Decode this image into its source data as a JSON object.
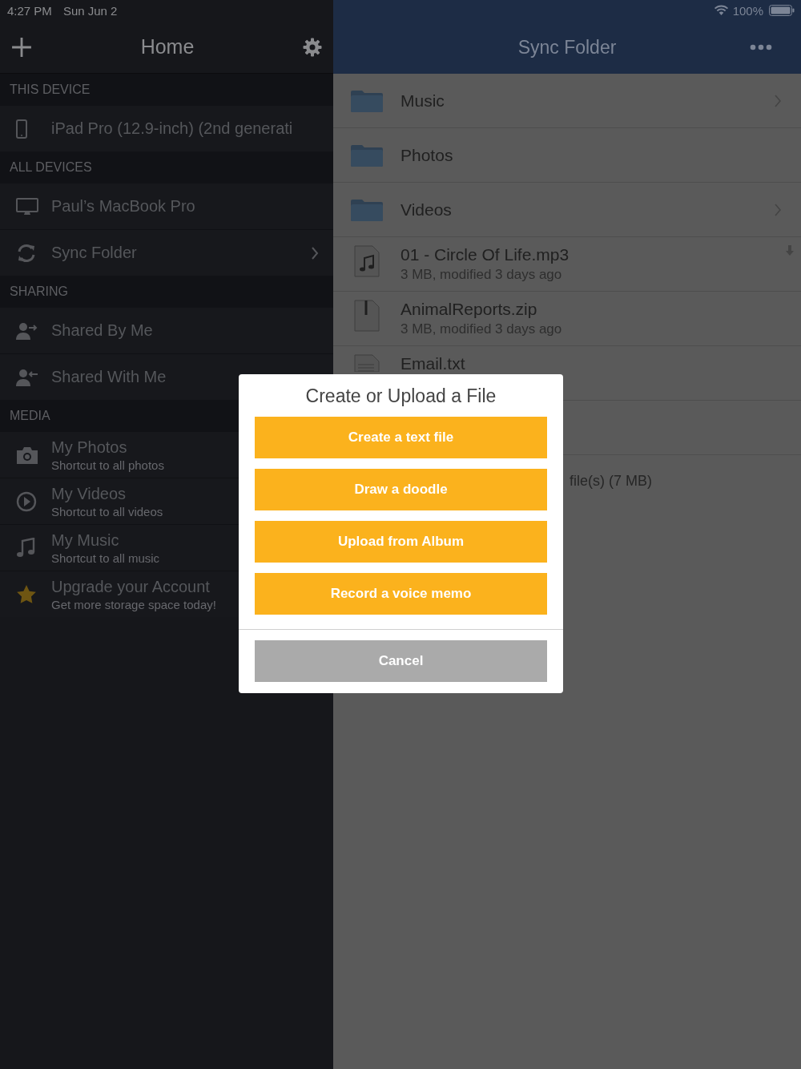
{
  "status_bar": {
    "time": "4:27 PM",
    "date": "Sun Jun 2",
    "battery": "100%"
  },
  "sidebar": {
    "title": "Home",
    "sections": [
      {
        "heading": "THIS DEVICE",
        "items": [
          {
            "kind": "tablet",
            "label": "iPad Pro (12.9-inch) (2nd generati",
            "chevron": false
          }
        ]
      },
      {
        "heading": "ALL DEVICES",
        "items": [
          {
            "kind": "computer",
            "label": "Paul’s MacBook Pro",
            "chevron": false
          },
          {
            "kind": "sync",
            "label": "Sync Folder",
            "chevron": true
          }
        ]
      },
      {
        "heading": "SHARING",
        "items": [
          {
            "kind": "share-out",
            "label": "Shared By Me",
            "chevron": false
          },
          {
            "kind": "share-in",
            "label": "Shared With Me",
            "chevron": false
          }
        ]
      },
      {
        "heading": "MEDIA",
        "items": [
          {
            "kind": "camera",
            "label": "My Photos",
            "subtitle": "Shortcut to all photos"
          },
          {
            "kind": "play",
            "label": "My Videos",
            "subtitle": "Shortcut to all videos"
          },
          {
            "kind": "music",
            "label": "My Music",
            "subtitle": "Shortcut to all music"
          },
          {
            "kind": "star",
            "label": "Upgrade your Account",
            "subtitle": "Get more storage space today!"
          }
        ]
      }
    ]
  },
  "main": {
    "title": "Sync Folder",
    "files": [
      {
        "kind": "folder",
        "name": "Music",
        "chevron": true
      },
      {
        "kind": "folder",
        "name": "Photos",
        "chevron": false
      },
      {
        "kind": "folder",
        "name": "Videos",
        "chevron": true
      },
      {
        "kind": "audio",
        "name": "01 - Circle Of Life.mp3",
        "detail": "3 MB, modified 3 days ago",
        "downloaded": true
      },
      {
        "kind": "zip",
        "name": "AnimalReports.zip",
        "detail": "3 MB, modified 3 days ago",
        "downloaded": false
      },
      {
        "kind": "text",
        "name": "Email.txt",
        "downloaded": false
      },
      {
        "kind": "blank"
      }
    ],
    "summary": "file(s) (7 MB)"
  },
  "dialog": {
    "title": "Create or Upload a File",
    "actions": [
      "Create a text file",
      "Draw a doodle",
      "Upload from Album",
      "Record a voice memo"
    ],
    "cancel": "Cancel"
  }
}
